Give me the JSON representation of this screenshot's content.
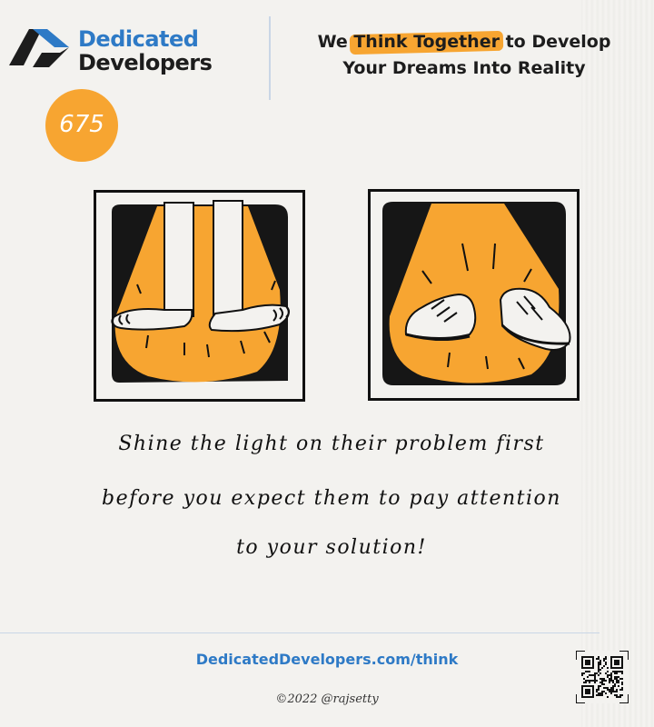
{
  "brand": {
    "line1": "Dedicated",
    "line2": "Developers"
  },
  "tagline": {
    "prefix": "We ",
    "highlight": "Think Together",
    "suffix": " to Develop",
    "line2": "Your Dreams Into Reality"
  },
  "badge": {
    "number": "675"
  },
  "caption": {
    "line1": "Shine the light on their problem first",
    "line2": "before you expect them to pay attention",
    "line3": "to your solution!"
  },
  "footer": {
    "url": "DedicatedDevelopers.com/think",
    "copyright": "©2022 @rajsetty"
  },
  "colors": {
    "accent_orange": "#f7a531",
    "brand_blue": "#2e7ac6",
    "ink": "#1d1d1d"
  },
  "icons": {
    "logo": "dedicated-developers-logo",
    "qr": "qr-code"
  }
}
